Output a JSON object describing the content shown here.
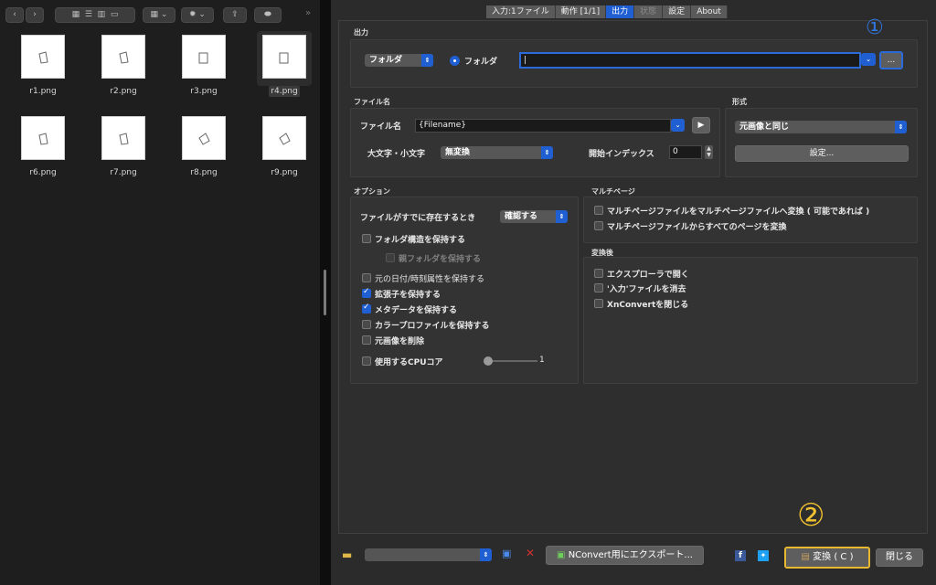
{
  "finder": {
    "files": [
      {
        "name": "r1.png"
      },
      {
        "name": "r2.png"
      },
      {
        "name": "r3.png"
      },
      {
        "name": "r4.png"
      },
      {
        "name": "r6.png"
      },
      {
        "name": "r7.png"
      },
      {
        "name": "r8.png"
      },
      {
        "name": "r9.png"
      }
    ],
    "toolbar": {
      "back": "‹",
      "forward": "›",
      "more": "»"
    }
  },
  "tabs": [
    {
      "label": "入力:1ファイル"
    },
    {
      "label": "動作 [1/1]"
    },
    {
      "label": "出力"
    },
    {
      "label": "状態"
    },
    {
      "label": "設定"
    },
    {
      "label": "About"
    }
  ],
  "output": {
    "title": "出力",
    "mode_select": "フォルダ",
    "radio_label": "フォルダ",
    "path_value": "|",
    "browse_label": "..."
  },
  "filename": {
    "title": "ファイル名",
    "label": "ファイル名",
    "value": "{Filename}",
    "case_label": "大文字・小文字",
    "case_value": "無変換",
    "index_label": "開始インデックス",
    "index_value": "0"
  },
  "format": {
    "title": "形式",
    "value": "元画像と同じ",
    "settings_label": "設定..."
  },
  "options": {
    "title": "オプション",
    "exists_label": "ファイルがすでに存在するとき",
    "exists_value": "確認する",
    "keep_folder": "フォルダ構造を保持する",
    "keep_parent": "親フォルダを保持する",
    "keep_date": "元の日付/時刻属性を保持する",
    "keep_ext": "拡張子を保持する",
    "keep_meta": "メタデータを保持する",
    "keep_color": "カラープロファイルを保持する",
    "delete_orig": "元画像を削除",
    "cpu_label": "使用するCPUコア",
    "cpu_value": "1"
  },
  "multipage": {
    "title": "マルチページ",
    "opt1": "マルチページファイルをマルチページファイルへ変換 ( 可能であれば )",
    "opt2": "マルチページファイルからすべてのページを変換"
  },
  "after": {
    "title": "変換後",
    "opt1": "エクスプローラで開く",
    "opt2": "'入力'ファイルを消去",
    "opt3": "XnConvertを閉じる"
  },
  "bottom": {
    "export_label": "NConvert用にエクスポート...",
    "convert_label": "変換 ( C )",
    "close_label": "閉じる"
  },
  "annotations": {
    "one": "①",
    "two": "②"
  },
  "colors": {
    "accent": "#1f5fd1",
    "annotation": "#f2c230"
  }
}
